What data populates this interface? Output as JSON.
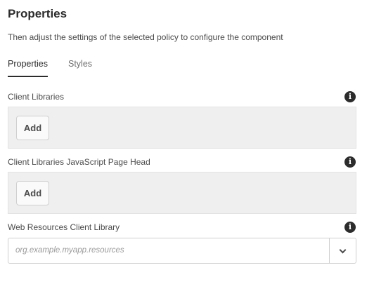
{
  "header": {
    "title": "Properties",
    "description": "Then adjust the settings of the selected policy to configure the component"
  },
  "tabs": [
    {
      "label": "Properties",
      "selected": true
    },
    {
      "label": "Styles",
      "selected": false
    }
  ],
  "fields": {
    "client_libraries": {
      "label": "Client Libraries",
      "add_label": "Add",
      "info_glyph": "i"
    },
    "client_libraries_js_head": {
      "label": "Client Libraries JavaScript Page Head",
      "add_label": "Add",
      "info_glyph": "i"
    },
    "web_resources": {
      "label": "Web Resources Client Library",
      "placeholder": "org.example.myapp.resources",
      "info_glyph": "i"
    }
  },
  "icons": {
    "info": "info-icon",
    "dropdown": "chevron-down-icon"
  },
  "colors": {
    "text_dark": "#2c2c2c",
    "multifield_bg": "#efefef"
  }
}
